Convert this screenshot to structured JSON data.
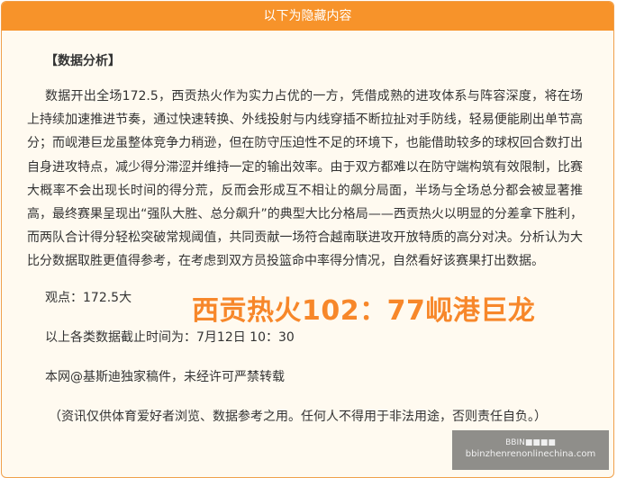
{
  "panel": {
    "header_title": "以下为隐藏内容"
  },
  "article": {
    "section_title": "【数据分析】",
    "body": "数据开出全场172.5，西贡热火作为实力占优的一方，凭借成熟的进攻体系与阵容深度，将在场上持续加速推进节奏，通过快速转换、外线投射与内线穿插不断拉扯对手防线，轻易便能刷出单节高分；而岘港巨龙虽整体竞争力稍逊，但在防守压迫性不足的环境下，也能借助较多的球权回合数打出自身进攻特点，减少得分滞涩并维持一定的输出效率。由于双方都难以在防守端构筑有效限制，比赛大概率不会出现长时间的得分荒，反而会形成互不相让的飙分局面，半场与全场总分都会被显著推高，最终赛果呈现出“强队大胜、总分飙升”的典型大比分格局——西贡热火以明显的分差拿下胜利，而两队合计得分轻松突破常规阈值，共同贡献一场符合越南联进攻开放特质的高分对决。分析认为大比分数据取胜更值得参考，在考虑到双方员投篮命中率得分情况，自然看好该赛果打出数据。",
    "opinion": "观点：172.5大",
    "deadline": "以上各类数据截止时间为：7月12日 10：30",
    "copyright": "本网@基斯迪独家稿件，未经许可严禁转载",
    "disclaimer": "（资讯仅供体育爱好者浏览、数据参考之用。任何人不得用于非法用途，否则责任自负。）"
  },
  "score_overlay": "西贡热火102：77岘港巨龙",
  "watermark": {
    "top": "BBIN■■■■",
    "url": "bbinzhenrenonlinechina.com"
  },
  "colors": {
    "header_bg": "#f7932a",
    "panel_bg": "#fffaf0",
    "score_text": "#f7872a"
  }
}
